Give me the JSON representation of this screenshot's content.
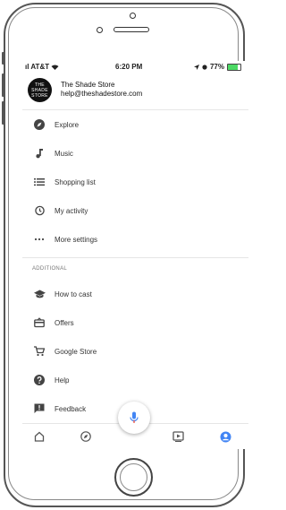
{
  "status_bar": {
    "carrier": "ıl AT&T",
    "time": "6:20 PM",
    "battery": "77%",
    "battery_level": 0.77
  },
  "account": {
    "avatar_text": [
      "THE",
      "SHADE",
      "STORE"
    ],
    "name": "The Shade Store",
    "email": "help@theshadestore.com"
  },
  "menu": {
    "items": [
      {
        "label": "Explore",
        "icon": "compass-filled-icon"
      },
      {
        "label": "Music",
        "icon": "music-note-icon"
      },
      {
        "label": "Shopping list",
        "icon": "list-icon"
      },
      {
        "label": "My activity",
        "icon": "history-icon"
      },
      {
        "label": "More settings",
        "icon": "more-horizontal-icon"
      }
    ],
    "section_header": "ADDITIONAL",
    "additional_items": [
      {
        "label": "How to cast",
        "icon": "graduation-cap-icon"
      },
      {
        "label": "Offers",
        "icon": "offers-icon"
      },
      {
        "label": "Google Store",
        "icon": "shopping-cart-icon"
      },
      {
        "label": "Help",
        "icon": "help-icon"
      },
      {
        "label": "Feedback",
        "icon": "feedback-icon"
      }
    ]
  },
  "bottom_nav": [
    "home-icon",
    "explore-icon",
    "updates-icon",
    "account-icon"
  ],
  "colors": {
    "accent_blue": "#4285f4",
    "icon_gray": "#444444",
    "divider": "#e6e6e6"
  }
}
